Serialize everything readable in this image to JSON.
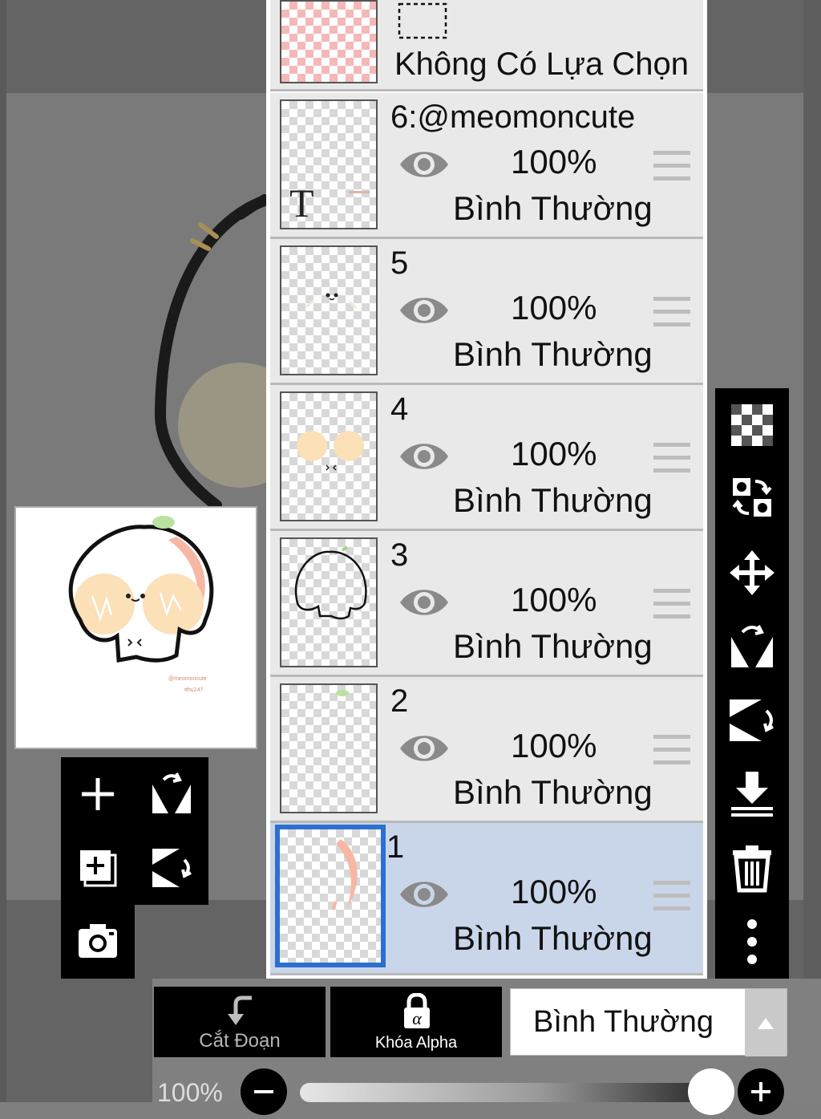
{
  "app": {
    "colors": {
      "canvas": "#7a7a7a",
      "panel": "#e9e9e9",
      "selected_layer": "#c9d6ea",
      "selected_border": "#2c6fd1",
      "toolbar": "#000000"
    }
  },
  "layers": {
    "selection": {
      "label": "Không Có Lựa Chọn",
      "icon": "dashed-rectangle-icon"
    },
    "items": [
      {
        "name": "6:@meomoncute",
        "opacity": "100%",
        "blend": "Bình Thường",
        "visible": true,
        "type": "text",
        "thumb_letter": "T"
      },
      {
        "name": "5",
        "opacity": "100%",
        "blend": "Bình Thường",
        "visible": true
      },
      {
        "name": "4",
        "opacity": "100%",
        "blend": "Bình Thường",
        "visible": true
      },
      {
        "name": "3",
        "opacity": "100%",
        "blend": "Bình Thường",
        "visible": true
      },
      {
        "name": "2",
        "opacity": "100%",
        "blend": "Bình Thường",
        "visible": true
      },
      {
        "name": "1",
        "opacity": "100%",
        "blend": "Bình Thường",
        "visible": true,
        "selected": true
      }
    ]
  },
  "right_toolbar": [
    "transparency-icon",
    "swap-layer-icon",
    "move-icon",
    "flip-horizontal-icon",
    "flip-vertical-icon",
    "merge-down-icon",
    "trash-icon",
    "more-icon"
  ],
  "left_toolbar": [
    "add-layer-icon",
    "flip-horizontal-icon",
    "duplicate-layer-icon",
    "flip-vertical-icon",
    "camera-icon"
  ],
  "preview": {
    "watermark_line1": "@meomoncute",
    "watermark_line2": "#hu247"
  },
  "bottom_bar": {
    "clip_label": "Cắt Đoạn",
    "alpha_lock_label": "Khóa Alpha",
    "blend_mode": "Bình Thường",
    "opacity_label": "100%",
    "opacity_value": 1.0
  }
}
